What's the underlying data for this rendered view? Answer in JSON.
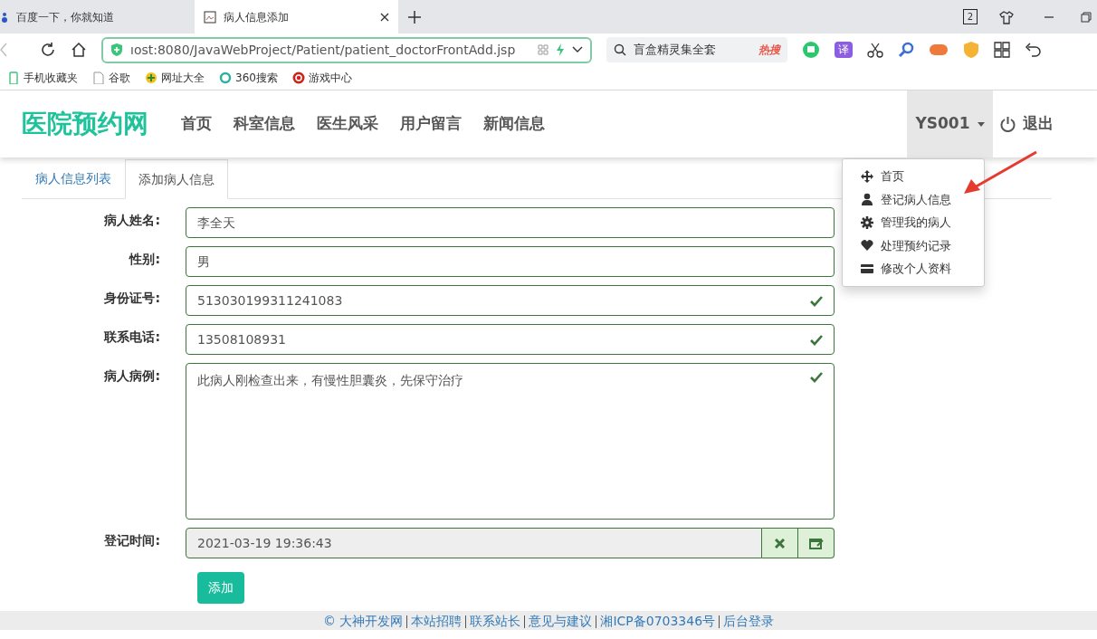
{
  "browser": {
    "tabs": [
      {
        "title": "百度一下，你就知道",
        "selected": false
      },
      {
        "title": "病人信息添加",
        "selected": true
      }
    ],
    "tab_count": "2",
    "address": "ıost:8080/JavaWebProject/Patient/patient_doctorFrontAdd.jsp",
    "search_text": "盲盒精灵集全套",
    "search_badge": "热搜",
    "translate_label": "译",
    "bookmarks": [
      "手机收藏夹",
      "谷歌",
      "网址大全",
      "360搜索",
      "游戏中心"
    ]
  },
  "navbar": {
    "brand": "医院预约网",
    "links": [
      "首页",
      "科室信息",
      "医生风采",
      "用户留言",
      "新闻信息"
    ],
    "user": "YS001",
    "logout": "退出",
    "user_menu": [
      {
        "label": "首页",
        "kind": "move"
      },
      {
        "label": "登记病人信息",
        "kind": "user"
      },
      {
        "label": "管理我的病人",
        "kind": "gear"
      },
      {
        "label": "处理预约记录",
        "kind": "heart"
      },
      {
        "label": "修改个人资料",
        "kind": "card"
      }
    ]
  },
  "tabs": [
    {
      "label": "病人信息列表",
      "selected": false
    },
    {
      "label": "添加病人信息",
      "selected": true
    }
  ],
  "form": {
    "fields": [
      {
        "label": "病人姓名:",
        "value": "李全天",
        "kind": "text"
      },
      {
        "label": "性别:",
        "value": "男",
        "kind": "text"
      },
      {
        "label": "身份证号:",
        "value": "513030199311241083",
        "kind": "text",
        "valid": true
      },
      {
        "label": "联系电话:",
        "value": "13508108931",
        "kind": "text",
        "valid": true
      },
      {
        "label": "病人病例:",
        "value": "此病人刚检查出来，有慢性胆囊炎，先保守治疗",
        "kind": "textarea",
        "valid": true
      },
      {
        "label": "登记时间:",
        "value": "2021-03-19 19:36:43",
        "kind": "datetime"
      }
    ],
    "submit": "添加"
  },
  "footer": [
    "© 大神开发网",
    "本站招聘",
    "联系站长",
    "意见与建议",
    "湘ICP备0703346号",
    "后台登录"
  ]
}
